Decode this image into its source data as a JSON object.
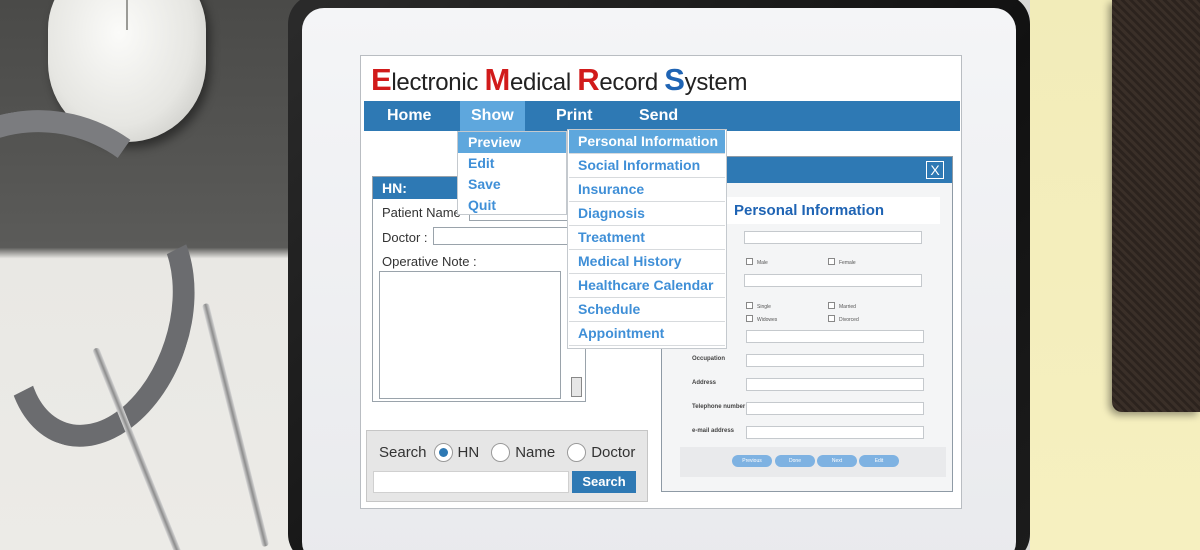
{
  "app": {
    "title_parts": [
      {
        "cap": "E",
        "rest": "lectronic ",
        "color": "#d11b1b"
      },
      {
        "cap": "M",
        "rest": "edical ",
        "color": "#d11b1b"
      },
      {
        "cap": "R",
        "rest": "ecord ",
        "color": "#d11b1b"
      },
      {
        "cap": "S",
        "rest": "ystem",
        "color": "#1f64b4"
      }
    ]
  },
  "menubar": {
    "items": [
      "Home",
      "Show",
      "Print",
      "Send"
    ],
    "active": "Show"
  },
  "show_menu": {
    "items": [
      "Preview",
      "Edit",
      "Save",
      "Quit"
    ],
    "highlighted": "Preview"
  },
  "preview_submenu": {
    "items": [
      "Personal Information",
      "Social Information",
      "Insurance",
      "Diagnosis",
      "Treatment",
      "Medical History",
      "Healthcare Calendar",
      "Schedule",
      "Appointment"
    ],
    "highlighted": "Personal Information"
  },
  "form": {
    "header": "HN:",
    "patient_name_label": "Patient Name",
    "doctor_label": "Doctor :",
    "operative_note_label": "Operative Note :"
  },
  "search": {
    "label": "Search",
    "options": [
      "HN",
      "Name",
      "Doctor"
    ],
    "selected": "HN",
    "button": "Search"
  },
  "dialog": {
    "close": "X",
    "title": "Personal Information",
    "gender_options": [
      "Male",
      "Female"
    ],
    "status_options": [
      "Single",
      "Married",
      "Widowes",
      "Divorced"
    ],
    "labels": {
      "occupation": "Occupation",
      "address": "Address",
      "telephone": "Telephone number",
      "email": "e-mail address"
    },
    "buttons": [
      "Previous",
      "Done",
      "Next",
      "Edit"
    ]
  },
  "colors": {
    "accent": "#2e79b4",
    "highlight": "#5ea7dd",
    "link": "#3f8fd7"
  }
}
